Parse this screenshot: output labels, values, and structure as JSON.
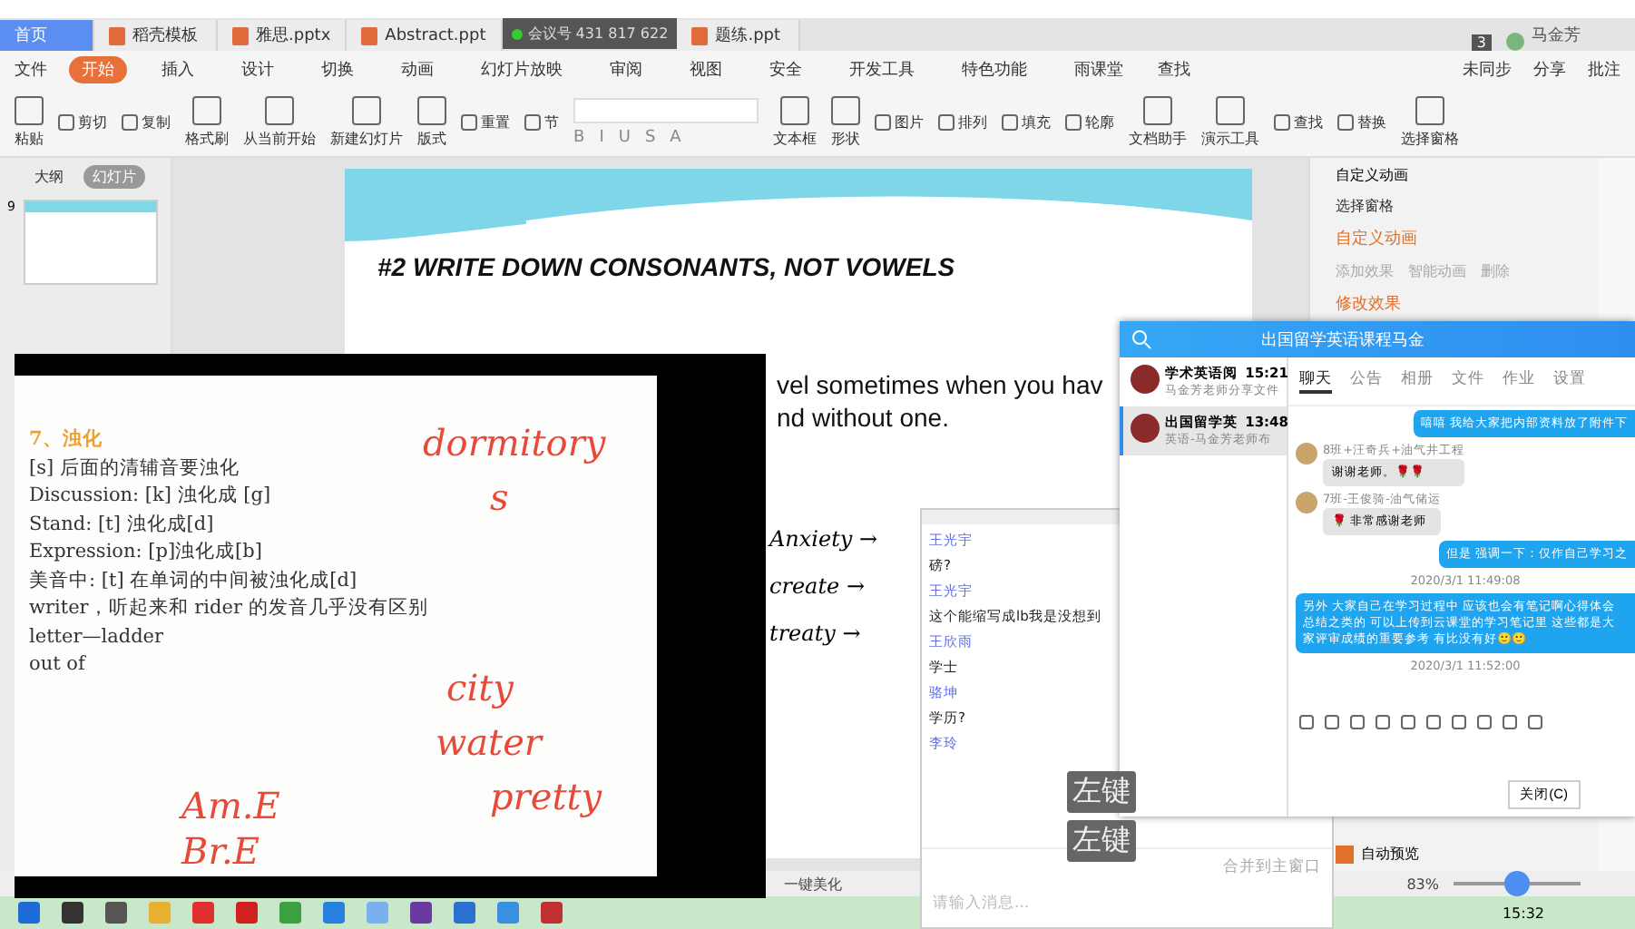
{
  "document_tabs": [
    {
      "label": "首页",
      "selected": true,
      "kind": "home"
    },
    {
      "label": "稻壳模板",
      "selected": false,
      "kind": "template"
    },
    {
      "label": "雅思.pptx",
      "selected": false,
      "kind": "file"
    },
    {
      "label": "Abstract.ppt",
      "selected": false,
      "kind": "file"
    },
    {
      "label": "题练.ppt",
      "selected": false,
      "kind": "file"
    }
  ],
  "meeting_badge": "会议号 431 817 622",
  "window_count": "3",
  "user_name": "马金芳",
  "file_menu": "文件",
  "menu": [
    {
      "label": "开始",
      "selected": true
    },
    {
      "label": "插入",
      "selected": false
    },
    {
      "label": "设计",
      "selected": false
    },
    {
      "label": "切换",
      "selected": false
    },
    {
      "label": "动画",
      "selected": false
    },
    {
      "label": "幻灯片放映",
      "selected": false
    },
    {
      "label": "审阅",
      "selected": false
    },
    {
      "label": "视图",
      "selected": false
    },
    {
      "label": "安全",
      "selected": false
    },
    {
      "label": "开发工具",
      "selected": false
    },
    {
      "label": "特色功能",
      "selected": false
    },
    {
      "label": "雨课堂",
      "selected": false
    }
  ],
  "search_menu": "查找",
  "account_actions": [
    "未同步",
    "分享",
    "批注"
  ],
  "ribbon": [
    {
      "label": "粘贴",
      "kind": "large"
    },
    {
      "label": "剪切",
      "kind": "small"
    },
    {
      "label": "复制",
      "kind": "small"
    },
    {
      "label": "格式刷",
      "kind": "large"
    },
    {
      "label": "从当前开始",
      "kind": "large"
    },
    {
      "label": "新建幻灯片",
      "kind": "large"
    },
    {
      "label": "版式",
      "kind": "large"
    },
    {
      "label": "重置",
      "kind": "small"
    },
    {
      "label": "节",
      "kind": "small"
    },
    {
      "kind": "format"
    },
    {
      "label": "文本框",
      "kind": "large"
    },
    {
      "label": "形状",
      "kind": "large"
    },
    {
      "label": "图片",
      "kind": "small"
    },
    {
      "label": "排列",
      "kind": "small"
    },
    {
      "label": "填充",
      "kind": "small"
    },
    {
      "label": "轮廓",
      "kind": "small"
    },
    {
      "label": "文档助手",
      "kind": "large"
    },
    {
      "label": "演示工具",
      "kind": "large"
    },
    {
      "label": "查找",
      "kind": "small"
    },
    {
      "label": "替换",
      "kind": "small"
    },
    {
      "label": "选择窗格",
      "kind": "large"
    }
  ],
  "format_buttons": [
    "B",
    "I",
    "U",
    "S",
    "A"
  ],
  "outline_tabs": [
    {
      "label": "大纲",
      "selected": false
    },
    {
      "label": "幻灯片",
      "selected": true
    }
  ],
  "thumbnail_number": "9",
  "slide": {
    "title": "#2 WRITE DOWN CONSONANTS, NOT VOWELS",
    "lines": [
      "vel sometimes when you hav",
      "nd without one."
    ]
  },
  "side_pane": {
    "title": "自定义动画",
    "items": [
      {
        "label": "选择窗格",
        "kind": "link"
      },
      {
        "label": "自定义动画",
        "kind": "heading"
      },
      {
        "label": "添加效果",
        "kind": "button"
      },
      {
        "label": "智能动画",
        "kind": "button"
      },
      {
        "label": "删除",
        "kind": "button"
      },
      {
        "label": "修改效果",
        "kind": "heading"
      }
    ],
    "auto_preview": {
      "label": "自动预览",
      "checked": true
    }
  },
  "status": {
    "beautify": "一键美化",
    "zoom": "83%",
    "level": 0.5
  },
  "taskbar_clock": "15:32",
  "whiteboard": {
    "heading": "7、浊化",
    "lines": [
      "[s] 后面的清辅音要浊化",
      "Discussion: [k] 浊化成 [g]",
      "Stand: [t] 浊化成[d]",
      "Expression: [p]浊化成[b]",
      "美音中: [t] 在单词的中间被浊化成[d]",
      "writer，听起来和 rider 的发音几乎没有区别",
      "letter—ladder",
      "out of"
    ],
    "handwriting": [
      "dormitory",
      "s",
      "city",
      "water",
      "pretty",
      "Am.E",
      "Br.E"
    ]
  },
  "slide_notes": [
    "Anxiety →",
    "create →",
    "treaty →"
  ],
  "live_chat": {
    "messages": [
      {
        "sender": "王光宇",
        "text": "磅?"
      },
      {
        "sender": "王光宇",
        "text": "这个能缩写成lb我是没想到"
      },
      {
        "sender": "王欣雨",
        "text": "学士"
      },
      {
        "sender": "骆坤",
        "text": "学历?"
      },
      {
        "sender": "李玲"
      }
    ],
    "merge": "合并到主窗口",
    "placeholder": "请输入消息..."
  },
  "key_hints": [
    "左键",
    "左键"
  ],
  "group_chat": {
    "title": "出国留学英语课程马金",
    "conversations": [
      {
        "name": "学术英语阅",
        "time": "15:21",
        "preview": "马金芳老师分享文件",
        "selected": false
      },
      {
        "name": "出国留学英",
        "time": "13:48",
        "preview": "英语-马金芳老师布",
        "selected": true
      }
    ],
    "tabs": [
      {
        "label": "聊天",
        "selected": true
      },
      {
        "label": "公告",
        "selected": false
      },
      {
        "label": "相册",
        "selected": false
      },
      {
        "label": "文件",
        "selected": false
      },
      {
        "label": "作业",
        "selected": false
      },
      {
        "label": "设置",
        "selected": false
      }
    ],
    "messages": [
      {
        "kind": "mine",
        "text": "嘻嘻 我给大家把内部资料放了附件下"
      },
      {
        "kind": "other",
        "sender": "8班+汪奇兵+油气井工程",
        "text": "谢谢老师。🌹🌹"
      },
      {
        "kind": "other",
        "sender": "7班-王俊骑-油气储运",
        "text": "🌹 非常感谢老师"
      },
      {
        "kind": "mine",
        "text": "但是 强调一下：仅作自己学习之"
      },
      {
        "kind": "time",
        "text": "2020/3/1 11:49:08"
      },
      {
        "kind": "mine",
        "text": "另外 大家自己在学习过程中 应该也会有笔记啊心得体会总结之类的 可以上传到云课堂的学习笔记里 这些都是大家评审成绩的重要参考 有比没有好🙂🙂"
      },
      {
        "kind": "time",
        "text": "2020/3/1 11:52:00"
      }
    ],
    "close_button": "关闭(C)"
  }
}
